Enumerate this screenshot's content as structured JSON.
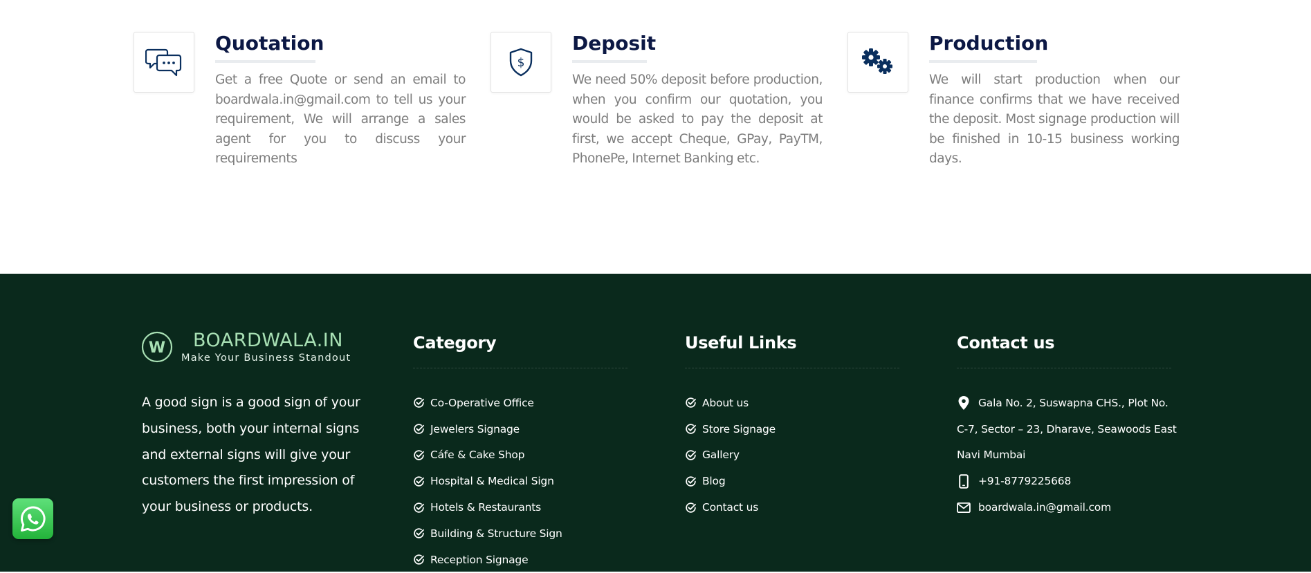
{
  "steps": [
    {
      "icon": "chat-bubbles-icon",
      "title": "Quotation",
      "description": "Get a free Quote or send an email to boardwala.in@gmail.com to tell us your requirement, We will arrange a sales agent for you to discuss your requirements"
    },
    {
      "icon": "shield-dollar-icon",
      "title": "Deposit",
      "description": "We need 50% deposit before production, when you confirm our quotation, you would be asked to pay the deposit at first, we accept Cheque, GPay, PayTM, PhonePe, Internet Banking etc."
    },
    {
      "icon": "gears-icon",
      "title": "Production",
      "description": "We will start production when our finance confirms that we have received the deposit. Most signage production will be finished in 10-15 business working days."
    }
  ],
  "footer": {
    "brand": {
      "name": "BOARDWALA.IN",
      "tagline": "Make Your Business Standout",
      "logo_letter": "W",
      "logo_color": "#a8e0b4"
    },
    "about": "A good sign is a good sign of your business, both your internal signs and external signs will give your customers the first impression of your business or products.",
    "category": {
      "title": "Category",
      "items": [
        "Co-Operative Office",
        "Jewelers Signage",
        "Cáfe & Cake Shop",
        "Hospital & Medical Sign",
        "Hotels & Restaurants",
        "Building & Structure Sign",
        "Reception Signage"
      ]
    },
    "useful_links": {
      "title": "Useful Links",
      "items": [
        "About us",
        "Store Signage",
        "Gallery",
        "Blog",
        "Contact us"
      ]
    },
    "contact": {
      "title": "Contact us",
      "address_line1": "Gala No. 2, Suswapna CHS., Plot No.",
      "address_line2": "C-7, Sector – 23, Dharave, Seawoods East",
      "address_line3": "Navi Mumbai",
      "phone": "+91-8779225668",
      "email": "boardwala.in@gmail.com"
    }
  },
  "colors": {
    "step_title": "#0c1844",
    "step_icon": "#0a2f5e",
    "footer_bg": "#0a291c",
    "whatsapp": "#25d366"
  },
  "whatsapp_button": {
    "icon": "whatsapp-icon"
  }
}
